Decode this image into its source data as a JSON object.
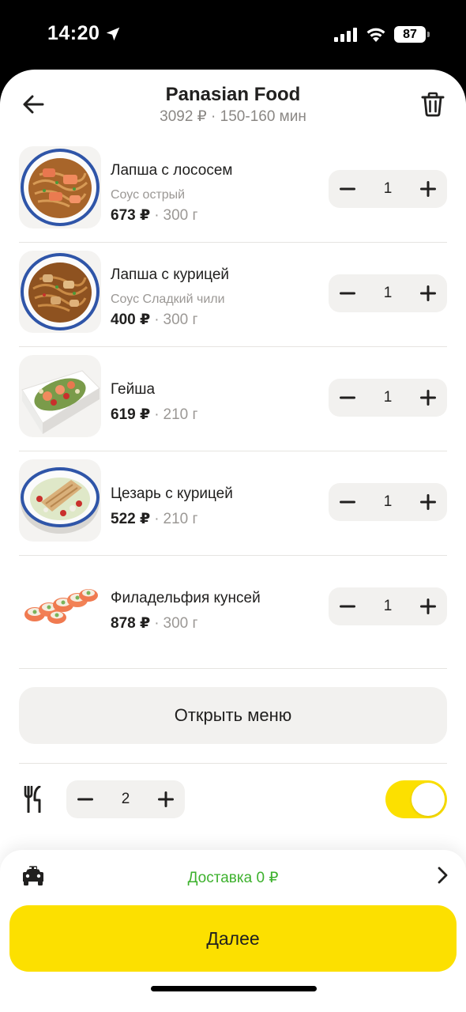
{
  "status_bar": {
    "time": "14:20",
    "battery": "87"
  },
  "header": {
    "title": "Panasian Food",
    "subtitle": "3092 ₽ · 150-160 мин"
  },
  "cart_items": [
    {
      "name": "Лапша с лососем",
      "sauce": "Соус острый",
      "price": "673 ₽",
      "weight": "300 г",
      "quantity": "1",
      "image": "noodles-salmon"
    },
    {
      "name": "Лапша с курицей",
      "sauce": "Соус Сладкий чили",
      "price": "400 ₽",
      "weight": "300 г",
      "quantity": "1",
      "image": "noodles-chicken"
    },
    {
      "name": "Гейша",
      "price": "619 ₽",
      "weight": "210 г",
      "quantity": "1",
      "image": "geisha-salad"
    },
    {
      "name": "Цезарь с курицей",
      "price": "522 ₽",
      "weight": "210 г",
      "quantity": "1",
      "image": "caesar-salad"
    },
    {
      "name": "Филадельфия кунсей",
      "price": "878 ₽",
      "weight": "300 г",
      "quantity": "1",
      "image": "philadelphia-roll"
    }
  ],
  "open_menu_label": "Открыть меню",
  "cutlery": {
    "count": "2",
    "enabled": true
  },
  "footer": {
    "delivery_text": "Доставка 0 ₽",
    "next_label": "Далее"
  },
  "colors": {
    "accent": "#fce000",
    "delivery_green": "#3db12d",
    "muted": "#9b9895",
    "surface": "#f2f1ef"
  },
  "icons": [
    "location-arrow-icon",
    "signal-icon",
    "wifi-icon",
    "back-arrow-icon",
    "trash-icon",
    "minus-icon",
    "plus-icon",
    "cutlery-icon",
    "car-icon",
    "chevron-right-icon"
  ]
}
